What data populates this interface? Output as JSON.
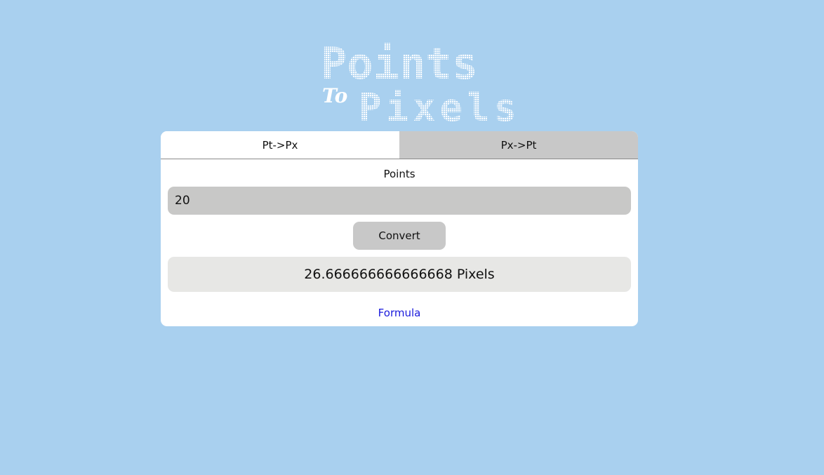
{
  "logo": {
    "line1": "Points",
    "connector": "To",
    "line2": "Pixels",
    "color": "#ffffff"
  },
  "tabs": [
    {
      "label": "Pt->Px",
      "active": true
    },
    {
      "label": "Px->Pt",
      "active": false
    }
  ],
  "converter": {
    "field_label": "Points",
    "input_value": "20",
    "convert_label": "Convert",
    "result": "26.666666666666668 Pixels"
  },
  "formula_link": "Formula",
  "colors": {
    "background": "#a9d0ef",
    "card": "#ffffff",
    "inactive_tab": "#c8c8c8",
    "input": "#c8c8c7",
    "result_box": "#e7e7e5",
    "link": "#1a1adc"
  }
}
